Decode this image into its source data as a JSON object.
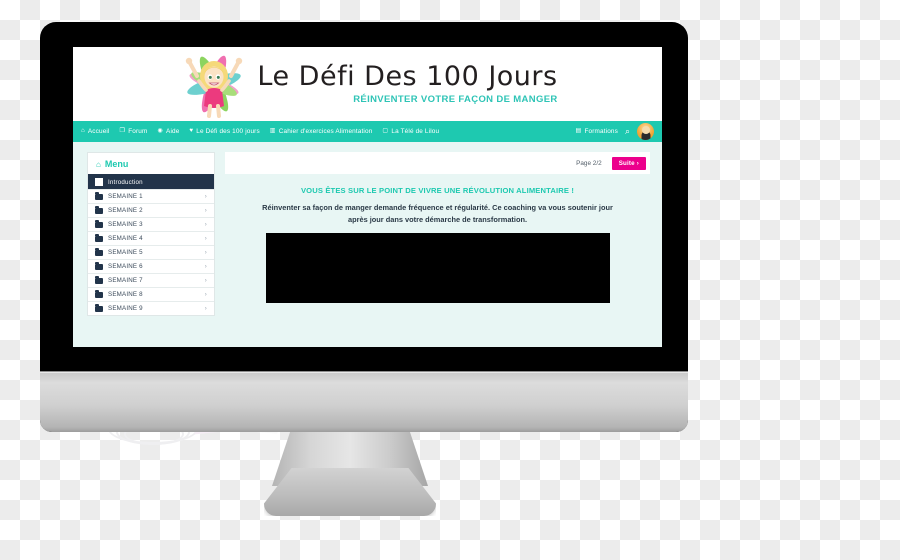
{
  "site": {
    "brand": {
      "title": "Le Défi Des 100 Jours",
      "subtitle": "RÉINVENTER VOTRE FAÇON DE MANGER",
      "logo_icon": "fairy-mascot-icon"
    },
    "colors": {
      "teal": "#1ec9b0",
      "teal_light": "#e8f6f4",
      "navy": "#22344a",
      "magenta": "#ec008c",
      "text_dark": "#2b3a47"
    }
  },
  "nav": {
    "items": [
      {
        "label": "Accueil",
        "icon": "home-icon"
      },
      {
        "label": "Forum",
        "icon": "comments-icon"
      },
      {
        "label": "Aide",
        "icon": "question-circle-icon"
      },
      {
        "label": "Le Défi des 100 jours",
        "icon": "heart-icon"
      },
      {
        "label": "Cahier d'exercices Alimentation",
        "icon": "book-icon"
      },
      {
        "label": "La Télé de Lilou",
        "icon": "tv-icon"
      }
    ],
    "right": {
      "formations_label": "Formations",
      "formations_icon": "video-icon",
      "search_icon": "search-icon",
      "avatar_icon": "user-avatar"
    }
  },
  "sidebar": {
    "title": "Menu",
    "title_icon": "home-icon",
    "items": [
      {
        "label": "Introduction",
        "icon": "checkbox-icon",
        "active": true,
        "chevron": ""
      },
      {
        "label": "SEMAINE 1",
        "icon": "folder-icon",
        "active": false,
        "chevron": "›"
      },
      {
        "label": "SEMAINE 2",
        "icon": "folder-icon",
        "active": false,
        "chevron": "›"
      },
      {
        "label": "SEMAINE 3",
        "icon": "folder-icon",
        "active": false,
        "chevron": "›"
      },
      {
        "label": "SEMAINE 4",
        "icon": "folder-icon",
        "active": false,
        "chevron": "›"
      },
      {
        "label": "SEMAINE 5",
        "icon": "folder-icon",
        "active": false,
        "chevron": "›"
      },
      {
        "label": "SEMAINE 6",
        "icon": "folder-icon",
        "active": false,
        "chevron": "›"
      },
      {
        "label": "SEMAINE 7",
        "icon": "folder-icon",
        "active": false,
        "chevron": "›"
      },
      {
        "label": "SEMAINE 8",
        "icon": "folder-icon",
        "active": false,
        "chevron": "›"
      },
      {
        "label": "SEMAINE 9",
        "icon": "folder-icon",
        "active": false,
        "chevron": "›"
      }
    ]
  },
  "main": {
    "page_count": "Page 2/2",
    "next_button": "Suite ›",
    "headline": "VOUS ÊTES SUR LE POINT DE VIVRE UNE RÉVOLUTION ALIMENTAIRE !",
    "paragraph": "Réinventer sa façon de manger demande fréquence et régularité. Ce coaching va vous soutenir jour après jour dans votre démarche de transformation.",
    "video_placeholder": "video-player"
  }
}
